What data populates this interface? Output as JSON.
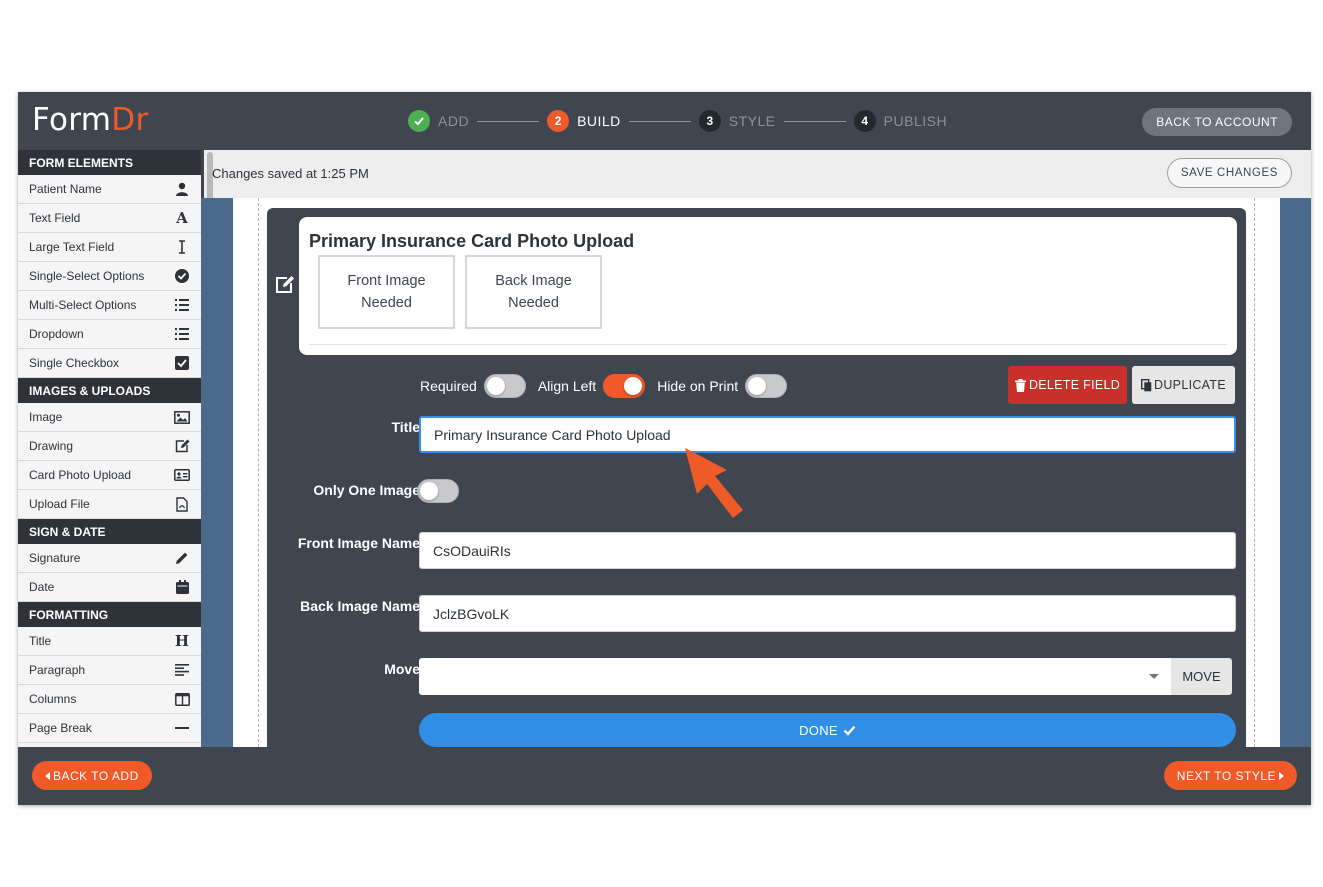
{
  "header": {
    "logo_part1": "Form",
    "logo_part2": "Dr",
    "steps": [
      {
        "number": "",
        "label": "ADD",
        "state": "done"
      },
      {
        "number": "2",
        "label": "BUILD",
        "state": "active"
      },
      {
        "number": "3",
        "label": "STYLE",
        "state": "pending"
      },
      {
        "number": "4",
        "label": "PUBLISH",
        "state": "pending"
      }
    ],
    "back_to_account": "BACK TO ACCOUNT"
  },
  "save_bar": {
    "status_text": "Changes saved at 1:25 PM",
    "save_label": "SAVE CHANGES"
  },
  "sidebar": {
    "sections": [
      {
        "title": "FORM ELEMENTS",
        "items": [
          {
            "label": "Patient Name",
            "icon": "user-icon"
          },
          {
            "label": "Text Field",
            "icon": "font-icon"
          },
          {
            "label": "Large Text Field",
            "icon": "text-cursor-icon"
          },
          {
            "label": "Single-Select Options",
            "icon": "check-circle-icon"
          },
          {
            "label": "Multi-Select Options",
            "icon": "list-icon"
          },
          {
            "label": "Dropdown",
            "icon": "list-icon"
          },
          {
            "label": "Single Checkbox",
            "icon": "checkbox-icon"
          }
        ]
      },
      {
        "title": "IMAGES & UPLOADS",
        "items": [
          {
            "label": "Image",
            "icon": "image-icon"
          },
          {
            "label": "Drawing",
            "icon": "edit-icon"
          },
          {
            "label": "Card Photo Upload",
            "icon": "id-card-icon"
          },
          {
            "label": "Upload File",
            "icon": "file-icon"
          }
        ]
      },
      {
        "title": "SIGN & DATE",
        "items": [
          {
            "label": "Signature",
            "icon": "pencil-icon"
          },
          {
            "label": "Date",
            "icon": "calendar-icon"
          }
        ]
      },
      {
        "title": "FORMATTING",
        "items": [
          {
            "label": "Title",
            "icon": "heading-icon"
          },
          {
            "label": "Paragraph",
            "icon": "align-left-icon"
          },
          {
            "label": "Columns",
            "icon": "columns-icon"
          },
          {
            "label": "Page Break",
            "icon": "minus-icon"
          }
        ]
      }
    ]
  },
  "editor": {
    "preview_title": "Primary Insurance Card Photo Upload",
    "front_box": "Front Image Needed",
    "back_box": "Back Image Needed",
    "toggles": [
      {
        "label": "Required",
        "on": false
      },
      {
        "label": "Align Left",
        "on": true
      },
      {
        "label": "Hide on Print",
        "on": false
      }
    ],
    "delete_label": "DELETE FIELD",
    "duplicate_label": "DUPLICATE",
    "title_label": "Title",
    "title_value": "Primary Insurance Card Photo Upload",
    "only_one_label": "Only One Image",
    "front_name_label": "Front Image Name",
    "front_name_value": "CsODauiRIs",
    "back_name_label": "Back Image Name",
    "back_name_value": "JclzBGvoLK",
    "move_label": "Move",
    "move_button": "MOVE",
    "done_label": "DONE"
  },
  "footer": {
    "back_label": "BACK TO ADD",
    "next_label": "NEXT TO STYLE"
  },
  "colors": {
    "accent": "#f05a28",
    "dark": "#3f4650",
    "primary_blue": "#2f8fe6",
    "danger": "#c9302c",
    "success": "#4caf50"
  }
}
